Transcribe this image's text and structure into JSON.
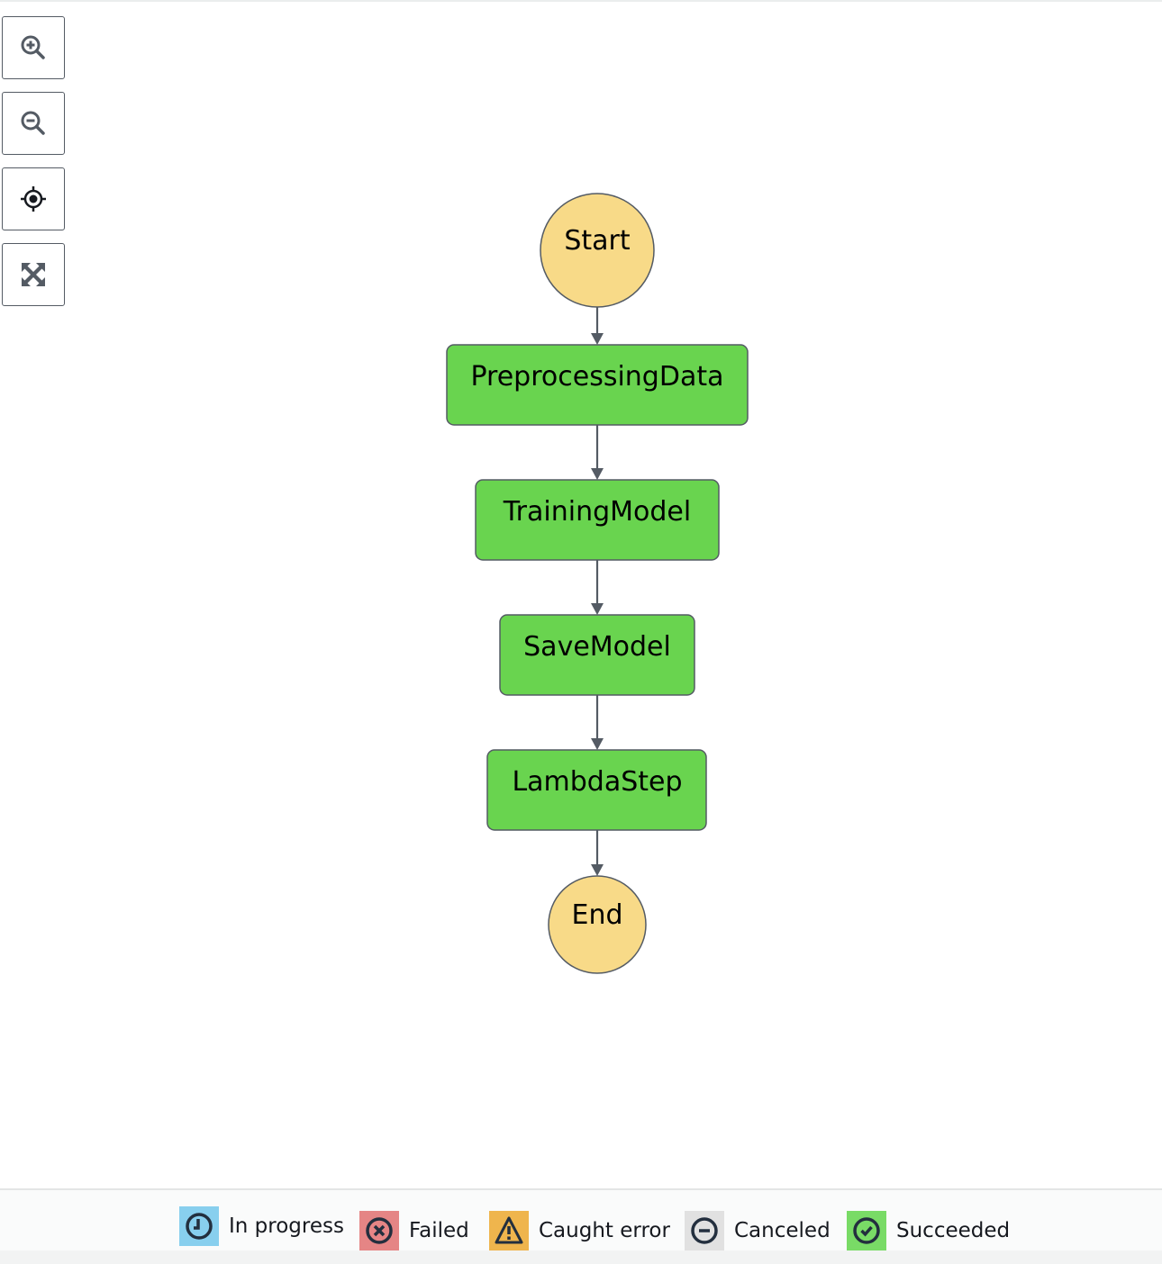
{
  "controls": [
    {
      "name": "zoom-in",
      "icon": "zoom-in-icon"
    },
    {
      "name": "zoom-out",
      "icon": "zoom-out-icon"
    },
    {
      "name": "center",
      "icon": "crosshair-icon"
    },
    {
      "name": "fit",
      "icon": "expand-icon"
    }
  ],
  "graph": {
    "nodes": [
      {
        "id": "start",
        "label": "Start",
        "type": "terminal"
      },
      {
        "id": "preprocessing",
        "label": "PreprocessingData",
        "type": "task",
        "status": "Succeeded"
      },
      {
        "id": "training",
        "label": "TrainingModel",
        "type": "task",
        "status": "Succeeded"
      },
      {
        "id": "save",
        "label": "SaveModel",
        "type": "task",
        "status": "Succeeded"
      },
      {
        "id": "lambda",
        "label": "LambdaStep",
        "type": "task",
        "status": "Succeeded"
      },
      {
        "id": "end",
        "label": "End",
        "type": "terminal"
      }
    ],
    "edges": [
      {
        "from": "start",
        "to": "preprocessing"
      },
      {
        "from": "preprocessing",
        "to": "training"
      },
      {
        "from": "training",
        "to": "save"
      },
      {
        "from": "save",
        "to": "lambda"
      },
      {
        "from": "lambda",
        "to": "end"
      }
    ],
    "colors": {
      "terminal": "#f8da88",
      "succeeded": "#69d44f",
      "border": "#545b64",
      "edge": "#545b64"
    }
  },
  "legend": [
    {
      "label": "In progress",
      "icon": "clock-icon",
      "color": "#88cfee"
    },
    {
      "label": "Failed",
      "icon": "x-circle-icon",
      "color": "#e58585"
    },
    {
      "label": "Caught error",
      "icon": "warning-icon",
      "color": "#efb54d"
    },
    {
      "label": "Canceled",
      "icon": "minus-circle-icon",
      "color": "#e1e1e1"
    },
    {
      "label": "Succeeded",
      "icon": "check-circle-icon",
      "color": "#79db66"
    }
  ]
}
